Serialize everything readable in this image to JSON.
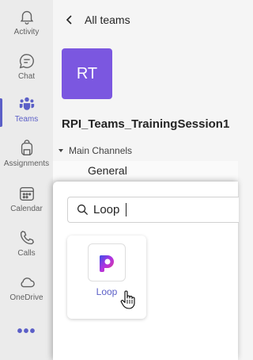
{
  "rail": {
    "items": [
      {
        "label": "Activity",
        "icon": "bell-icon"
      },
      {
        "label": "Chat",
        "icon": "chat-icon"
      },
      {
        "label": "Teams",
        "icon": "teams-icon",
        "active": true
      },
      {
        "label": "Assignments",
        "icon": "backpack-icon"
      },
      {
        "label": "Calendar",
        "icon": "calendar-icon"
      },
      {
        "label": "Calls",
        "icon": "phone-icon"
      },
      {
        "label": "OneDrive",
        "icon": "cloud-icon"
      }
    ],
    "more_label": "•••"
  },
  "pane": {
    "back_label": "All teams",
    "team_initials": "RT",
    "team_name": "RPI_Teams_TrainingSession1",
    "section_label": "Main Channels",
    "channel": "General"
  },
  "popup": {
    "search_value": "Loop",
    "result_app": "Loop"
  },
  "colors": {
    "accent": "#5b5fc7",
    "team_avatar": "#7b57e0",
    "rail_bg": "#ebebeb"
  }
}
